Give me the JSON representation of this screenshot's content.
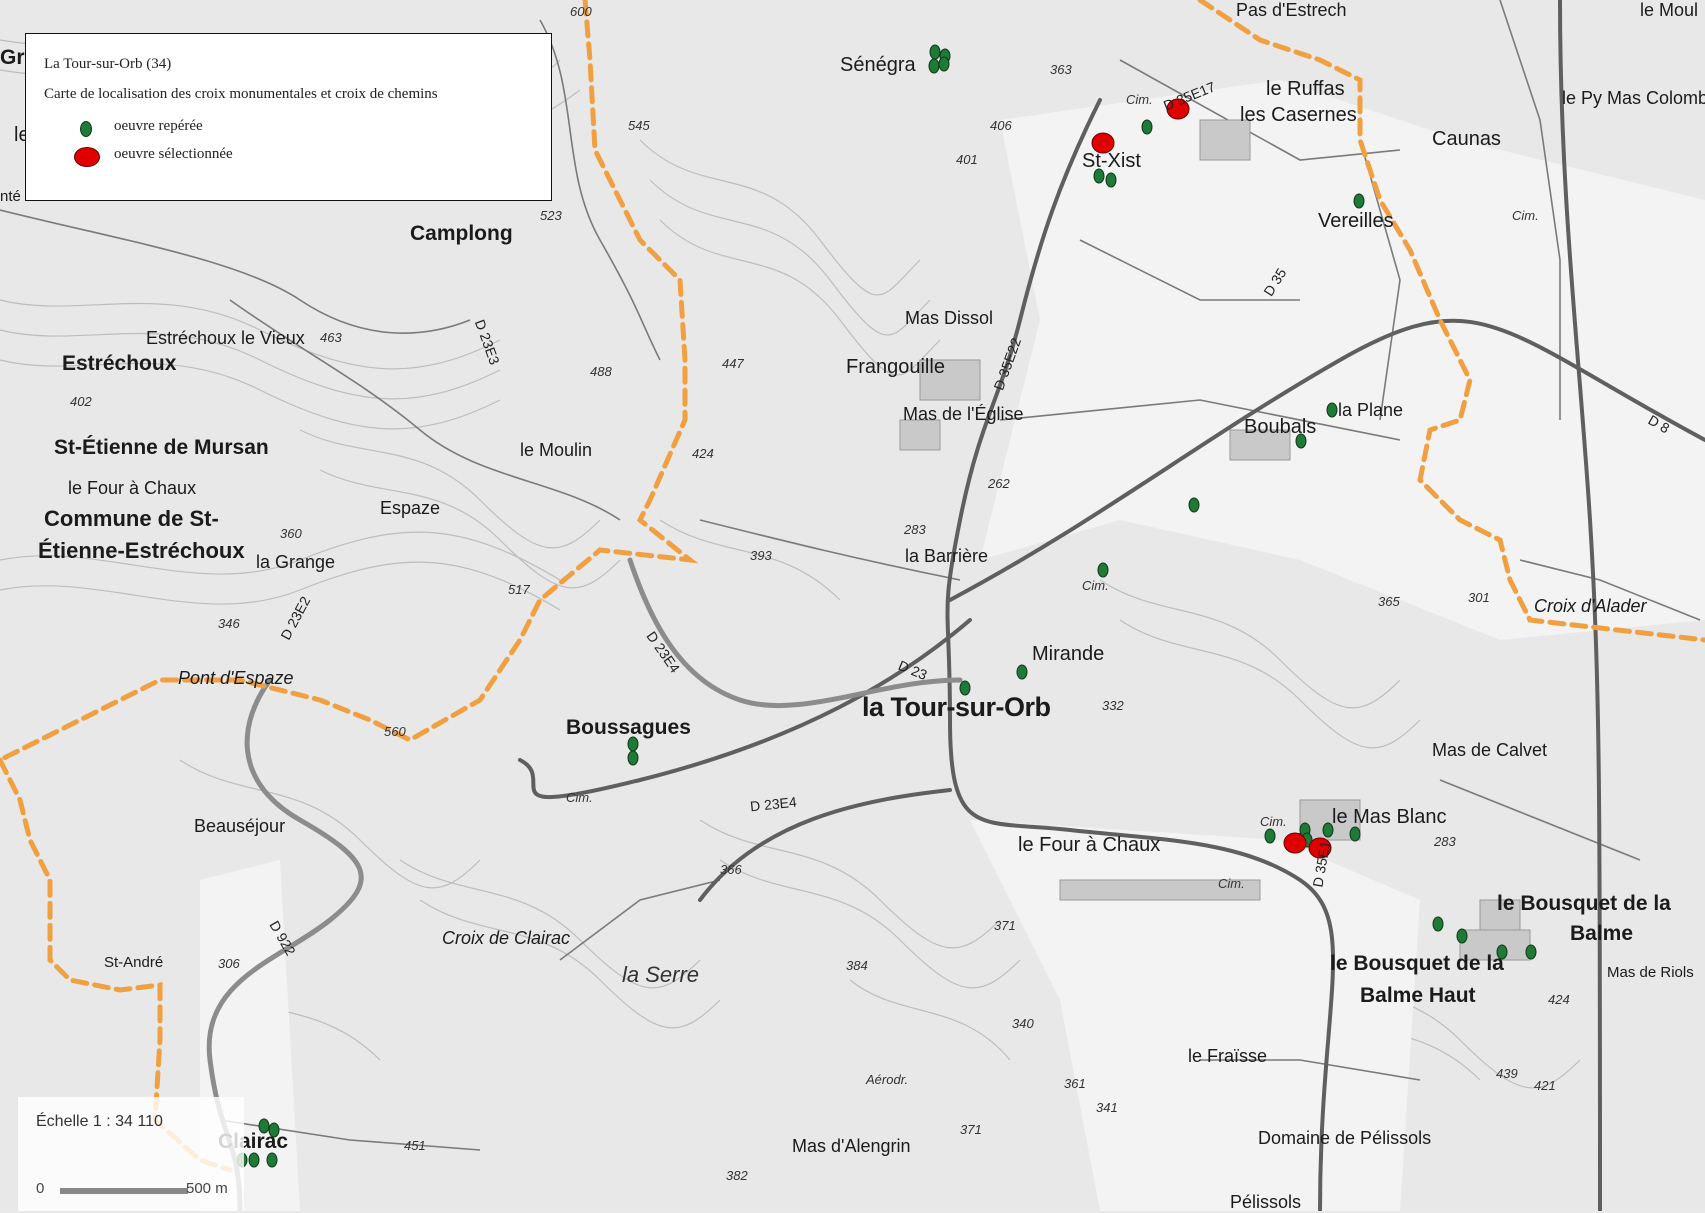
{
  "legend": {
    "title": "La Tour-sur-Orb (34)",
    "subtitle": "Carte de localisation des croix monumentales et croix de chemins",
    "items": [
      {
        "label": "oeuvre repérée",
        "color": "#1e7a36"
      },
      {
        "label": "oeuvre sélectionnée",
        "color": "#e00000"
      }
    ]
  },
  "scale": {
    "label": "Échelle 1 : 34 110",
    "zero": "0",
    "distance": "500 m"
  },
  "colors": {
    "boundary": "#f0a040",
    "repere": "#1e7a36",
    "selection": "#e00000"
  },
  "places": {
    "la_tour": "la Tour-sur-Orb",
    "camplong": "Camplong",
    "estrechoux": "Estréchoux",
    "st_etienne": "St-Étienne de Mursan",
    "commune_1": "Commune de St-",
    "commune_2": "Étienne-Estréchoux",
    "boussagues": "Boussagues",
    "clairac": "Clairac",
    "bousquet_haut_1": "le Bousquet de la",
    "bousquet_haut_2": "Balme Haut",
    "bousquet_1": "le Bousquet de la",
    "bousquet_2": "Balme",
    "senegra": "Sénégra",
    "st_xist": "St-Xist",
    "ruffas": "le Ruffas",
    "casernes": "les Casernes",
    "pas_estrech": "Pas d'Estrech",
    "caunas": "Caunas",
    "py_mas": "le Py Mas Colombi",
    "vereilles": "Vereilles",
    "mas_dissol": "Mas Dissol",
    "frangouille": "Frangouille",
    "mas_eglise": "Mas de l'Église",
    "boubals": "Boubals",
    "la_plane": "la Plane",
    "mirande": "Mirande",
    "barriere": "la Barrière",
    "le_moulin": "le Moulin",
    "espaze": "Espaze",
    "four_chaux_w": "le Four à Chaux",
    "four_chaux_e": "le Four à Chaux",
    "la_grange": "la Grange",
    "estrechoux_vieux": "Estréchoux le Vieux",
    "pont_espaze": "Pont d'Espaze",
    "beausejour": "Beauséjour",
    "st_andre": "St-André",
    "croix_clairac": "Croix de Clairac",
    "la_serre": "la Serre",
    "mas_blanc": "le Mas Blanc",
    "mas_calvet": "Mas de Calvet",
    "croix_alader": "Croix d'Alader",
    "le_fraisse": "le Fraïsse",
    "domaine_pelissols": "Domaine de Pélissols",
    "pelissols": "Pélissols",
    "mas_alengrin": "Mas d'Alengrin",
    "aerodr": "Aérodr.",
    "mas_riols": "Mas de Riols",
    "le_moul_edge": "le Moul",
    "gra_edge": "Gra",
    "le_edge": "le",
    "nte_edge": "nté"
  },
  "roads": [
    "D 35E17",
    "D 35",
    "D 35E22",
    "D 23E3",
    "D 23E2",
    "D 23E4",
    "D 23",
    "D 23E4",
    "D 922",
    "D 8",
    "D 35E1"
  ],
  "altitudes": [
    "545",
    "523",
    "463",
    "488",
    "447",
    "402",
    "424",
    "393",
    "360",
    "346",
    "517",
    "560",
    "406",
    "401",
    "363",
    "262",
    "283",
    "332",
    "365",
    "301",
    "366",
    "371",
    "384",
    "340",
    "361",
    "341",
    "371",
    "382",
    "451",
    "306",
    "283",
    "424",
    "439",
    "421",
    "600"
  ],
  "cim_labels": [
    "Cim.",
    "Cim.",
    "Cim.",
    "Cim.",
    "Cim.",
    "Cim."
  ],
  "markers_repere_count": 30,
  "markers_selection_count": 4
}
